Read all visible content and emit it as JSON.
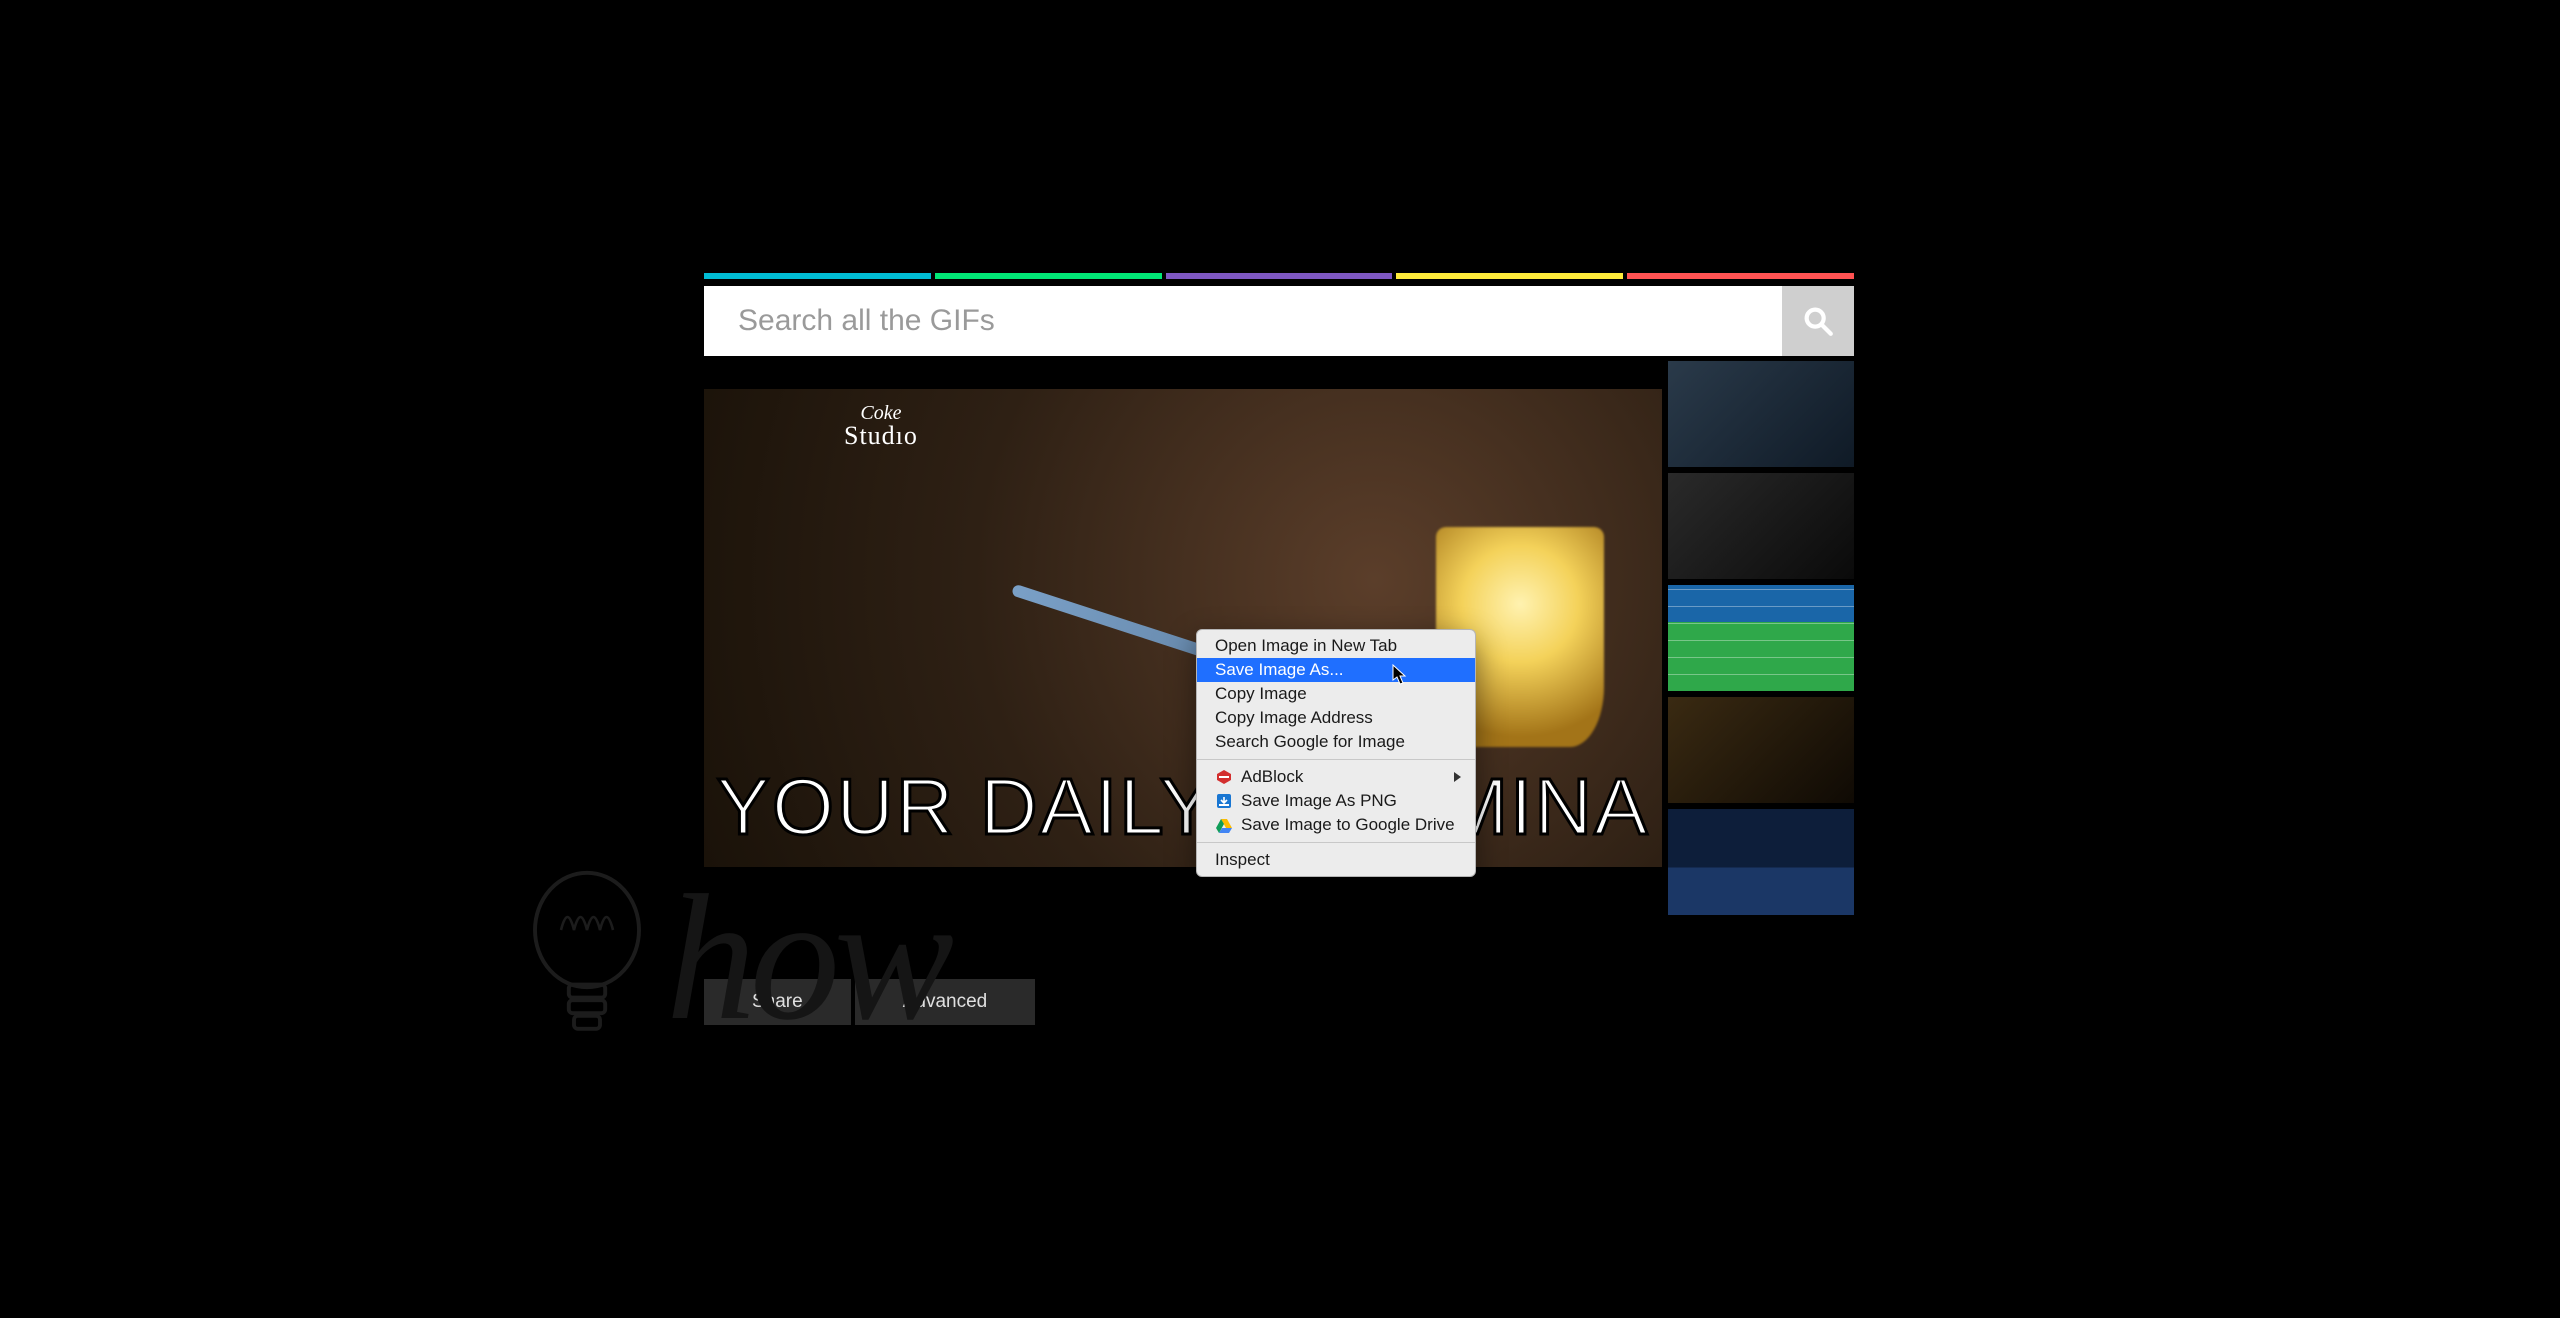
{
  "colors": {
    "strip": [
      "#00bcd4",
      "#00e676",
      "#7e57c2",
      "#ffeb3b",
      "#ff5252"
    ]
  },
  "search": {
    "placeholder": "Search all the GIFs",
    "value": ""
  },
  "main": {
    "watermark_line1": "Coke",
    "watermark_line2": "Studıo",
    "caption_visible": "YOUR DAILY DOS        MINA"
  },
  "actions": {
    "share": "Share",
    "advanced": "Advanced"
  },
  "context_menu": {
    "items": [
      {
        "label": "Open Image in New Tab"
      },
      {
        "label": "Save Image As...",
        "highlighted": true
      },
      {
        "label": "Copy Image"
      },
      {
        "label": "Copy Image Address"
      },
      {
        "label": "Search Google for Image"
      }
    ],
    "ext_items": [
      {
        "label": "AdBlock",
        "icon": "adblock",
        "submenu": true
      },
      {
        "label": "Save Image As PNG",
        "icon": "png"
      },
      {
        "label": "Save Image to Google Drive",
        "icon": "drive"
      }
    ],
    "inspect": "Inspect"
  },
  "watermark": {
    "how": "how"
  }
}
